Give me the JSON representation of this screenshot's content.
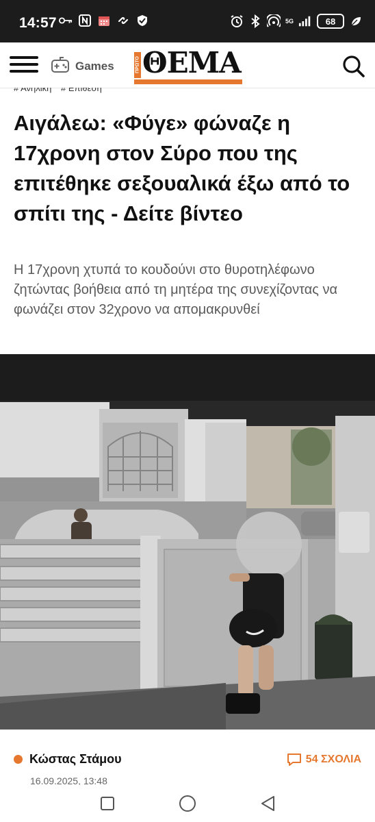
{
  "status_bar": {
    "time": "14:57",
    "battery": "68",
    "network": "5G",
    "left_icons": [
      "key-icon",
      "nfc-icon",
      "calendar-icon",
      "link-icon",
      "shield-icon"
    ],
    "right_icons": [
      "alarm-icon",
      "bluetooth-icon",
      "hotspot-icon",
      "signal-icon",
      "battery-icon",
      "leaf-icon"
    ]
  },
  "header": {
    "games_label": "Games",
    "logo_text": "ΘΕΜΑ",
    "logo_side_text": "ΠΡΩΤΟ",
    "brand_color": "#e5782e"
  },
  "article": {
    "tags": [
      "# Ανηλίκη",
      "# Επίθεση"
    ],
    "headline": "Αιγάλεω: «Φύγε» φώναζε η 17χρονη στον Σύρο που της επιτέθηκε σεξουαλικά έξω από το σπίτι της - Δείτε βίντεο",
    "lead": "Η 17χρονη χτυπά το κουδούνι στο θυροτηλέφωνο ζητώντας βοήθεια από τη μητέρα της συνεχίζοντας να φωνάζει στον 32χρονο να απομακρυνθεί",
    "author": "Κώστας Στάμου",
    "comments_label": "54 ΣΧΟΛΙΑ",
    "date": "16.09.2025, 13:48"
  },
  "nav": {
    "buttons": [
      "recent-apps-icon",
      "home-icon",
      "back-icon"
    ]
  }
}
